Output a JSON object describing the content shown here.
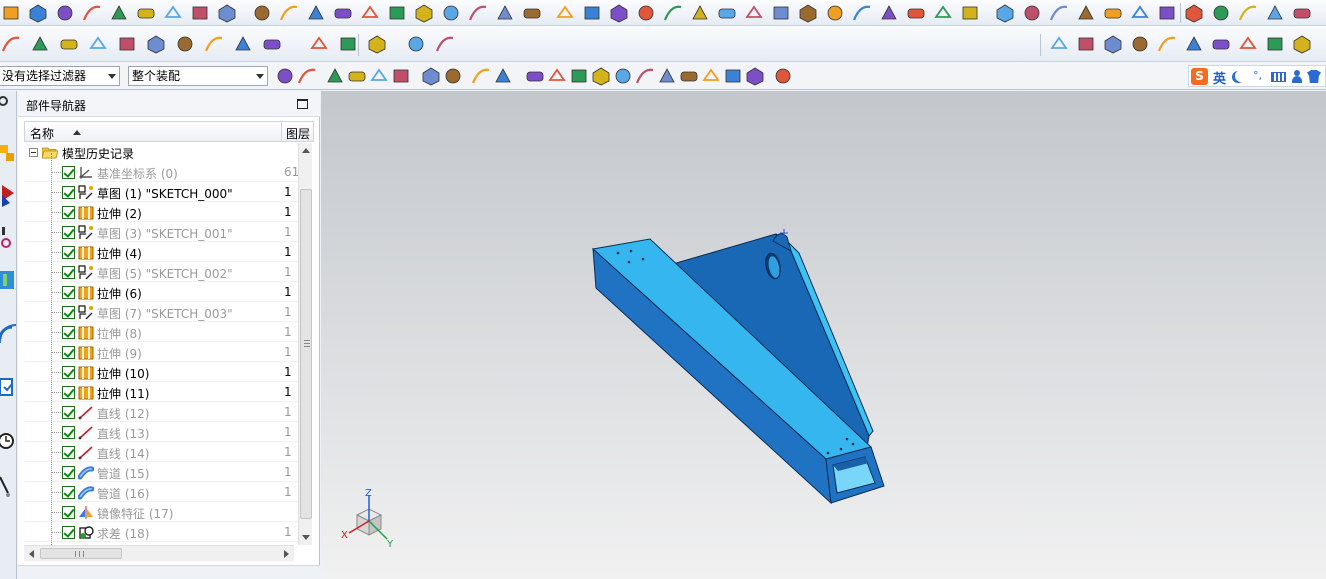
{
  "selection_bar": {
    "filter_value": "没有选择过滤器",
    "scope_value": "整个装配"
  },
  "ime": {
    "label": "英"
  },
  "navigator": {
    "title": "部件导航器",
    "columns": {
      "name": "名称",
      "layer": "图层"
    },
    "root": "模型历史记录",
    "items": [
      {
        "label": "基准坐标系 (0)",
        "layer": "61",
        "icon": "datum-csys-icon",
        "dim": true
      },
      {
        "label": "草图 (1) \"SKETCH_000\"",
        "layer": "1",
        "icon": "sketch-icon",
        "dim": false
      },
      {
        "label": "拉伸 (2)",
        "layer": "1",
        "icon": "extrude-icon",
        "dim": false
      },
      {
        "label": "草图 (3) \"SKETCH_001\"",
        "layer": "1",
        "icon": "sketch-icon",
        "dim": true
      },
      {
        "label": "拉伸 (4)",
        "layer": "1",
        "icon": "extrude-icon",
        "dim": false
      },
      {
        "label": "草图 (5) \"SKETCH_002\"",
        "layer": "1",
        "icon": "sketch-icon",
        "dim": true
      },
      {
        "label": "拉伸 (6)",
        "layer": "1",
        "icon": "extrude-icon",
        "dim": false
      },
      {
        "label": "草图 (7) \"SKETCH_003\"",
        "layer": "1",
        "icon": "sketch-icon",
        "dim": true
      },
      {
        "label": "拉伸 (8)",
        "layer": "1",
        "icon": "extrude-icon",
        "dim": true
      },
      {
        "label": "拉伸 (9)",
        "layer": "1",
        "icon": "extrude-icon",
        "dim": true
      },
      {
        "label": "拉伸 (10)",
        "layer": "1",
        "icon": "extrude-icon",
        "dim": false
      },
      {
        "label": "拉伸 (11)",
        "layer": "1",
        "icon": "extrude-icon",
        "dim": false
      },
      {
        "label": "直线 (12)",
        "layer": "1",
        "icon": "line-icon",
        "dim": true
      },
      {
        "label": "直线 (13)",
        "layer": "1",
        "icon": "line-icon",
        "dim": true
      },
      {
        "label": "直线 (14)",
        "layer": "1",
        "icon": "line-icon",
        "dim": true
      },
      {
        "label": "管道 (15)",
        "layer": "1",
        "icon": "tube-icon",
        "dim": true
      },
      {
        "label": "管道 (16)",
        "layer": "1",
        "icon": "tube-icon",
        "dim": true
      },
      {
        "label": "镜像特征 (17)",
        "layer": "",
        "icon": "mirror-feature-icon",
        "dim": true
      },
      {
        "label": "求差 (18)",
        "layer": "1",
        "icon": "subtract-icon",
        "dim": true
      }
    ]
  },
  "triad": {
    "x": "X",
    "y": "Y",
    "z": "Z"
  },
  "colors": {
    "part_top": "#35b6ee",
    "part_side": "#1f73c2",
    "part_dark": "#0d4f94",
    "gusset": "#1868b6",
    "edge": "#0a2d55"
  }
}
